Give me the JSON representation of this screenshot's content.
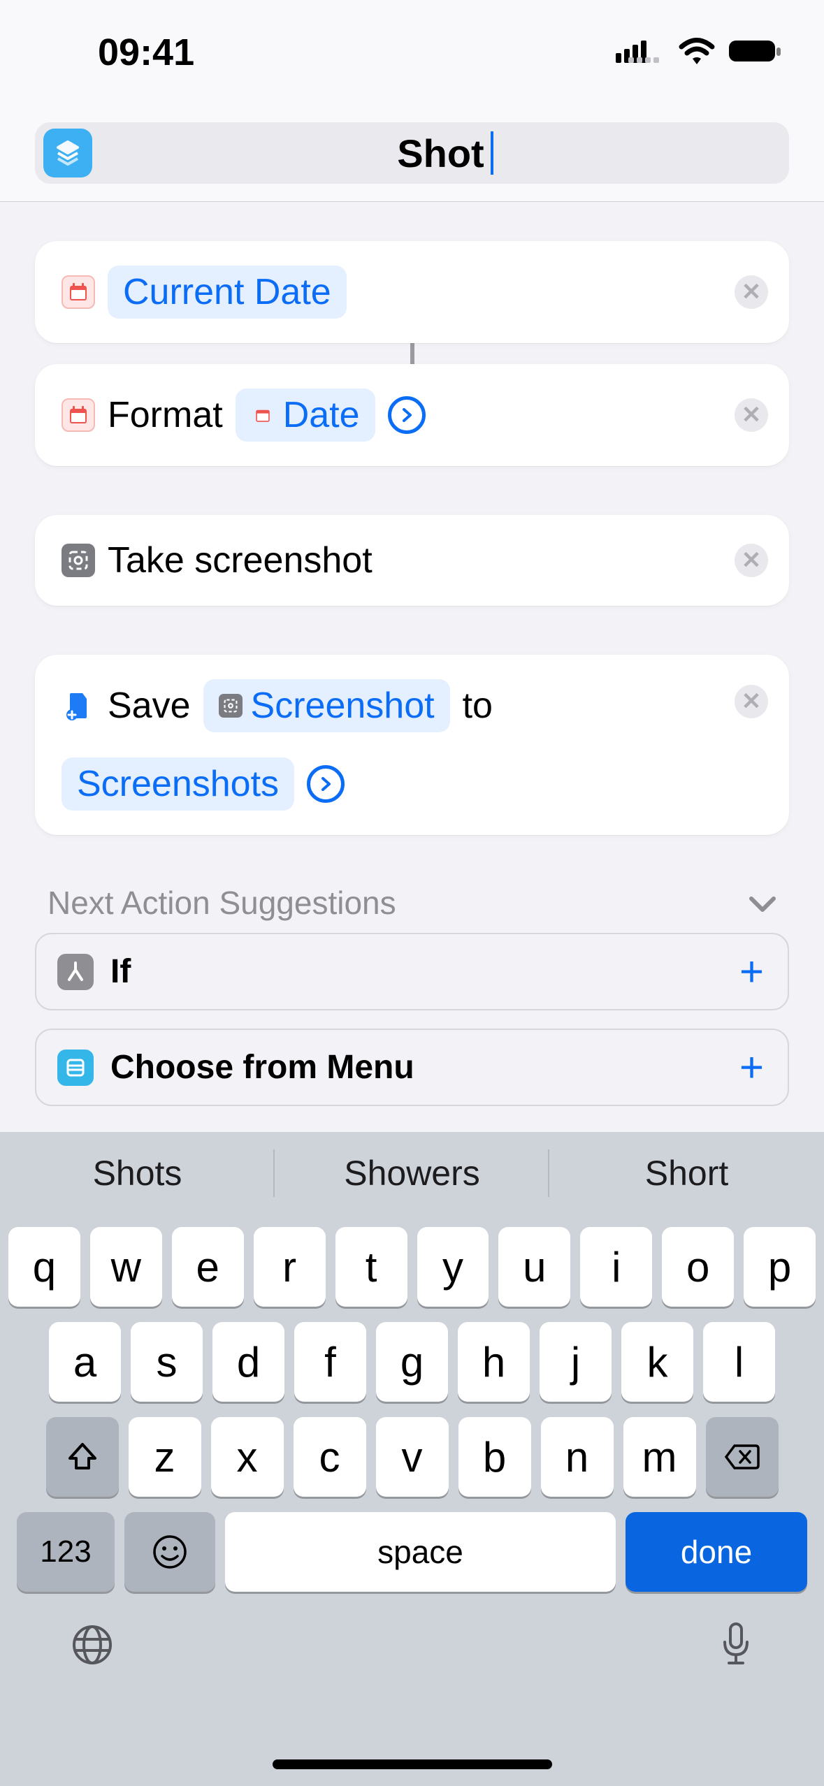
{
  "status": {
    "time": "09:41"
  },
  "header": {
    "shortcut_name": "Shot"
  },
  "actions": {
    "a1": {
      "pill": "Current Date"
    },
    "a2": {
      "label": "Format",
      "pill": "Date"
    },
    "a3": {
      "label": "Take screenshot"
    },
    "a4": {
      "label_pre": "Save",
      "pill1": "Screenshot",
      "label_mid": "to",
      "pill2": "Screenshots"
    }
  },
  "suggestions": {
    "title": "Next Action Suggestions",
    "items": [
      {
        "label": "If"
      },
      {
        "label": "Choose from Menu"
      }
    ]
  },
  "keyboard": {
    "suggest": [
      "Shots",
      "Showers",
      "Short"
    ],
    "row1": [
      "q",
      "w",
      "e",
      "r",
      "t",
      "y",
      "u",
      "i",
      "o",
      "p"
    ],
    "row2": [
      "a",
      "s",
      "d",
      "f",
      "g",
      "h",
      "j",
      "k",
      "l"
    ],
    "row3": [
      "z",
      "x",
      "c",
      "v",
      "b",
      "n",
      "m"
    ],
    "mode_key": "123",
    "space": "space",
    "done": "done"
  }
}
